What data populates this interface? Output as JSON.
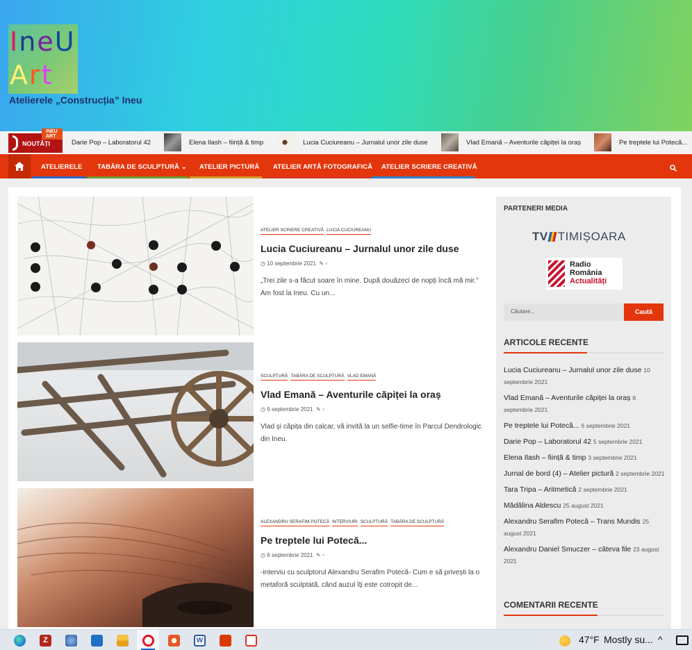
{
  "site": {
    "logo_line1": [
      "I",
      "n",
      "e",
      "U"
    ],
    "logo_line2": [
      "A",
      "r",
      "t"
    ],
    "tagline": "Atelierele „Construcția” Ineu"
  },
  "ticker": {
    "tag": "INEU ART",
    "label": "NOUTĂȚI",
    "items": [
      "Darie Pop – Laboratorul 42",
      "Elena Ilash – ființă & timp",
      "Lucia Cuciureanu – Jurnalul unor zile duse",
      "Vlad Emană – Aventurile căpiței la oraș",
      "Pe treptele lui Potecă..."
    ]
  },
  "nav": {
    "home_icon": "home-icon",
    "items": [
      "ATELIERELE",
      "TABĂRA DE SCULPTURĂ",
      "ATELIER PICTURĂ",
      "ATELIER ARTĂ FOTOGRAFICĂ",
      "ATELIER SCRIERE CREATIVĂ"
    ],
    "search_icon": "search-icon"
  },
  "posts": [
    {
      "cats": [
        "ATELIER SCRIERE CREATIVĂ",
        "LUCIA CUCIUREANU"
      ],
      "title": "Lucia Cuciureanu – Jurnalul unor zile duse",
      "date": "10 septembrie 2021",
      "excerpt": "„Trei zile s-a făcut soare în mine. După douăzeci de nopți încă mă mir.” Am fost la Ineu. Cu un..."
    },
    {
      "cats": [
        "SCULPTURĂ",
        "TABĂRA DE SCULPTURĂ",
        "VLAD EMANĂ"
      ],
      "title": "Vlad Emană – Aventurile căpiței la oraș",
      "date": "9 septembrie 2021",
      "excerpt": "Vlad și căpița din calcar, vă invită la un selfie-time în Parcul Dendrologic din Ineu."
    },
    {
      "cats": [
        "ALEXANDRU SERAFIM POTECĂ",
        "INTERVIURI",
        "SCULPTURĂ",
        "TABĂRA DE SCULPTURĂ"
      ],
      "title": "Pe treptele lui Potecă...",
      "date": "6 septembrie 2021",
      "excerpt": "-interviu cu sculptorul Alexandru Serafim Potecă- Cum e să privești la o metaforă sculptată, când auzul îți este cotropit de..."
    }
  ],
  "sidebar": {
    "media_heading": "PARTENERI MEDIA",
    "tvr_a": "TV",
    "tvr_b": "TIMIȘOARA",
    "radio_l1": "Radio",
    "radio_l2": "România",
    "radio_l3": "Actualități",
    "search_placeholder": "Căutare...",
    "search_button": "Caută",
    "recent_heading": "ARTICOLE RECENTE",
    "recent": [
      {
        "title": "Lucia Cuciureanu – Jurnalul unor zile duse",
        "date": "10 septembrie 2021"
      },
      {
        "title": "Vlad Emană – Aventurile căpiței la oraș",
        "date": "8 septembrie 2021"
      },
      {
        "title": "Pe treptele lui Potecă...",
        "date": "6 septembrie 2021"
      },
      {
        "title": "Darie Pop – Laboratorul 42",
        "date": "5 septembrie 2021"
      },
      {
        "title": "Elena Ilash – ființă & timp",
        "date": "3 septembrie 2021"
      },
      {
        "title": "Jurnal de bord (4) – Atelier pictură",
        "date": "2 septembrie 2021"
      },
      {
        "title": "Tara Tripa – Aritmetică",
        "date": "2 septembrie 2021"
      },
      {
        "title": "Mădălina Aldescu",
        "date": "25 august 2021"
      },
      {
        "title": "Alexandru Serafim Potecă – Trans Mundis",
        "date": "25 august 2021"
      },
      {
        "title": "Alexandru Daniel Smuczer – câteva file",
        "date": "23 august 2021"
      }
    ],
    "comments_heading": "COMENTARII RECENTE"
  },
  "taskbar": {
    "temperature": "47°F",
    "weather": "Mostly su...",
    "icons": [
      "edge-icon",
      "filezilla-icon",
      "network-icon",
      "mail-icon",
      "files-icon",
      "opera-icon",
      "paint-icon",
      "word-icon",
      "office-icon",
      "app-icon"
    ]
  },
  "colors": {
    "accent": "#e4360c",
    "dark_red": "#b21313"
  }
}
